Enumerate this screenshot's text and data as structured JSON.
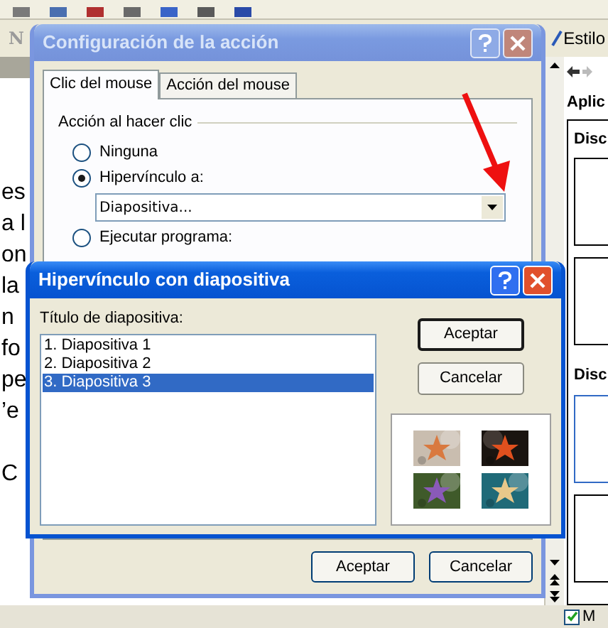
{
  "app": {
    "toolbar_letter": "N",
    "style_label": "Estilo",
    "task_pane": {
      "title": "Aplic",
      "sections": [
        {
          "heading": "Disc",
          "layouts": [
            {
              "selected": false
            },
            {
              "selected": false
            }
          ]
        },
        {
          "heading": "Disc",
          "layouts": [
            {
              "selected": true
            },
            {
              "selected": false
            }
          ]
        }
      ],
      "checkbox": {
        "label": "M",
        "checked": true
      }
    }
  },
  "slide": {
    "paragraphs": [
      [
        "es",
        "a l",
        "on",
        "la",
        "n",
        "fo",
        "pe",
        "’e"
      ],
      [
        "C"
      ]
    ]
  },
  "action_dialog": {
    "title": "Configuración de la acción",
    "active": false,
    "tabs": [
      {
        "label": "Clic del mouse",
        "selected": true
      },
      {
        "label": "Acción del mouse",
        "selected": false
      }
    ],
    "group_label": "Acción al hacer clic",
    "options": [
      {
        "label": "Ninguna",
        "selected": false
      },
      {
        "label": "Hipervínculo a:",
        "selected": true
      },
      {
        "label": "Ejecutar programa:",
        "selected": false
      }
    ],
    "hyperlink_value": "Diapositiva...",
    "buttons": [
      "Aceptar",
      "Cancelar"
    ]
  },
  "hyperlink_dialog": {
    "title": "Hipervínculo con diapositiva",
    "active": true,
    "list_label": "Título de diapositiva:",
    "slides": [
      {
        "label": "1. Diapositiva 1",
        "selected": false
      },
      {
        "label": "2. Diapositiva 2",
        "selected": false
      },
      {
        "label": "3. Diapositiva 3",
        "selected": true
      }
    ],
    "buttons": [
      {
        "label": "Aceptar",
        "default": true
      },
      {
        "label": "Cancelar",
        "default": false
      }
    ]
  }
}
